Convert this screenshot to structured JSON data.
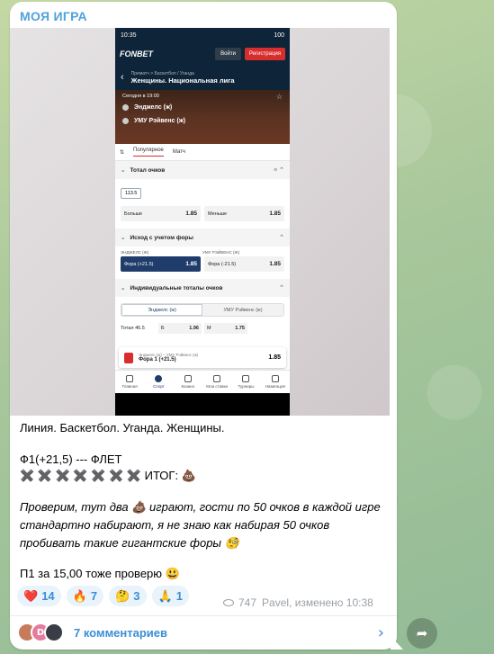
{
  "channel": {
    "name": "МОЯ ИГРА"
  },
  "screenshot": {
    "status": {
      "time": "10:35",
      "battery": "100"
    },
    "app": {
      "logo": "FONBET",
      "login": "Войти",
      "register": "Регистрация"
    },
    "breadcrumb": {
      "path": "Прематч > Баскетбол / Уганда",
      "title": "Женщины. Национальная лига"
    },
    "match": {
      "date": "Сегодня в 19:00",
      "team1": "Энджелс (ж)",
      "team2": "УМУ Рэйвенс (ж)"
    },
    "tabs": [
      "Популярное",
      "Матч"
    ],
    "sections": {
      "total": {
        "title": "Тотал очков",
        "chip": "113.5",
        "over": {
          "label": "Больше",
          "odd": "1.85"
        },
        "under": {
          "label": "Меньше",
          "odd": "1.85"
        }
      },
      "handicap": {
        "title": "Исход с учетом форы",
        "team1": "ЭНДЖЕЛС (Ж)",
        "team2": "УМУ РЭЙВЕНС (Ж)",
        "opt1": {
          "label": "Фора (+21.5)",
          "odd": "1.85"
        },
        "opt2": {
          "label": "Фора (-21.5)",
          "odd": "1.85"
        }
      },
      "individual": {
        "title": "Индивидуальные тоталы очков",
        "seg1": "Энджелс (ж)",
        "seg2": "УМУ Рэйвенс (ж)",
        "row_label": "Тотал 46.5",
        "b": "Б",
        "b_odd": "1.96",
        "m": "М",
        "m_odd": "1.75"
      }
    },
    "coupon": {
      "match": "Энджелс (ж) – УМУ Рэйвенс (ж)",
      "bet": "Фора 1 (+21.5)",
      "odd": "1.85"
    },
    "bottom_nav": [
      "Главная",
      "Спорт",
      "Казино",
      "Мои ставки",
      "Турниры",
      "Навигация"
    ]
  },
  "post": {
    "line1": "Линия. Баскетбол. Уганда. Женщины.",
    "line2": "Ф1(+21,5) --- ФЛЕТ",
    "line3_marks": "✖️ ✖️ ✖️ ✖️ ✖️ ✖️ ✖️",
    "line3_label": "ИТОГ: 💩",
    "para1": "Проверим, тут два 💩 играют, гости по 50 очков в каждой игре",
    "para2": "стандартно набирают, я не знаю как набирая 50 очков",
    "para3": "пробивать такие гигантские форы 🧐",
    "line4": "П1 за 15,00 тоже проверю 😃"
  },
  "reactions": [
    {
      "emoji": "❤️",
      "count": "14"
    },
    {
      "emoji": "🔥",
      "count": "7"
    },
    {
      "emoji": "🤔",
      "count": "3"
    },
    {
      "emoji": "🙏",
      "count": "1"
    }
  ],
  "meta": {
    "views": "747",
    "author": "Pavel, изменено 10:38"
  },
  "comments": {
    "label": "7 комментариев",
    "avatar2": "D"
  }
}
